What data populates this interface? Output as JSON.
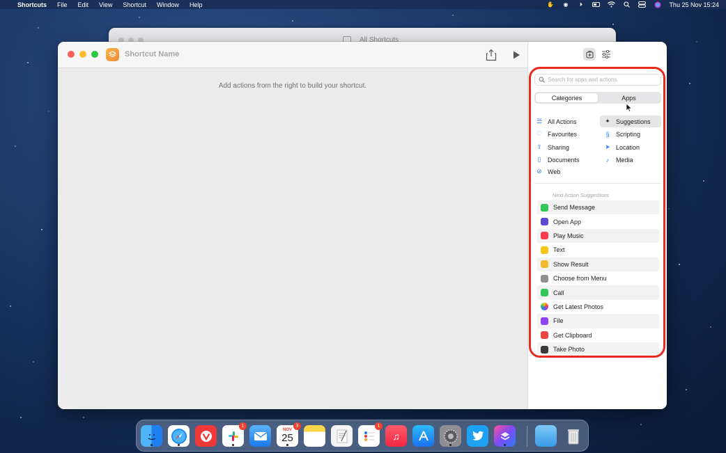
{
  "menubar": {
    "app_name": "Shortcuts",
    "menus": [
      "File",
      "Edit",
      "View",
      "Shortcut",
      "Window",
      "Help"
    ],
    "datetime": "Thu 25 Nov  15:24"
  },
  "background_window": {
    "title": "All Shortcuts"
  },
  "editor": {
    "shortcut_name": "Shortcut Name",
    "hint": "Add actions from the right to build your shortcut."
  },
  "sidebar": {
    "search_placeholder": "Search for apps and actions",
    "segments": [
      "Categories",
      "Apps"
    ],
    "active_segment": "Categories",
    "categories_left": [
      {
        "label": "All Actions",
        "icon": "list-icon"
      },
      {
        "label": "Favourites",
        "icon": "heart-icon"
      },
      {
        "label": "Sharing",
        "icon": "share-icon"
      },
      {
        "label": "Documents",
        "icon": "document-icon"
      },
      {
        "label": "Web",
        "icon": "compass-icon"
      }
    ],
    "categories_right": [
      {
        "label": "Suggestions",
        "icon": "sparkle-icon"
      },
      {
        "label": "Scripting",
        "icon": "scripting-icon"
      },
      {
        "label": "Location",
        "icon": "location-arrow-icon"
      },
      {
        "label": "Media",
        "icon": "music-note-icon"
      }
    ],
    "selected_category": "Suggestions",
    "suggestions_header": "Next Action Suggestions",
    "actions": [
      {
        "label": "Send Message",
        "color": "#34c759"
      },
      {
        "label": "Open App",
        "color": "#5b4bd6"
      },
      {
        "label": "Play Music",
        "color": "#fa3c4c"
      },
      {
        "label": "Text",
        "color": "#f5c518"
      },
      {
        "label": "Show Result",
        "color": "#f5b82e"
      },
      {
        "label": "Choose from Menu",
        "color": "#8e8e93"
      },
      {
        "label": "Call",
        "color": "#34c759"
      },
      {
        "label": "Get Latest Photos",
        "color": "#f0a030"
      },
      {
        "label": "File",
        "color": "#8e44f0"
      },
      {
        "label": "Get Clipboard",
        "color": "#ef4444"
      },
      {
        "label": "Take Photo",
        "color": "#3a3a3c"
      }
    ]
  },
  "dock": {
    "calendar_month": "NOV",
    "calendar_day": "25",
    "badges": {
      "slack": "1",
      "calendar": "3",
      "reminders": "1"
    }
  },
  "colors": {
    "highlight": "#e8291d",
    "accent": "#2f7bf5"
  }
}
